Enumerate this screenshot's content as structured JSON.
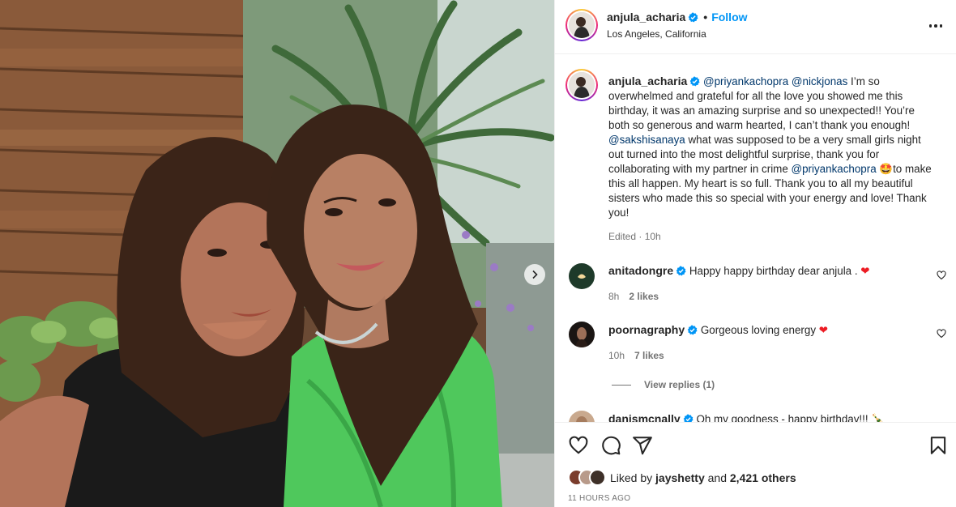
{
  "post": {
    "username": "anjula_acharia",
    "follow_label": "Follow",
    "dot": "•",
    "location": "Los Angeles, California"
  },
  "caption": {
    "username": "anjula_acharia",
    "mention1": "@priyankachopra",
    "mention2": "@nickjonas",
    "text1": " I’m so overwhelmed and grateful for all the love you showed me this birthday, it was an amazing surprise and so unexpected!! You’re both so generous and warm hearted, I can’t thank you enough! ",
    "mention3": "@sakshisanaya",
    "text2": " what was supposed to be a very small girls night out turned into the most delightful surprise, thank you for collaborating with my partner in crime ",
    "mention4": "@priyankachopra",
    "emoji": "🤩",
    "text3": "to make this all happen. My heart is so full. Thank you to all my beautiful sisters who made this so special with your energy and love! Thank you!",
    "meta": "Edited · 10h"
  },
  "comments": [
    {
      "username": "anitadongre",
      "text": "Happy happy birthday dear anjula . ",
      "emoji": "❤",
      "time": "8h",
      "likes": "2 likes"
    },
    {
      "username": "poornagraphy",
      "text": "Gorgeous loving energy ",
      "emoji": "❤",
      "time": "10h",
      "likes": "7 likes",
      "replies": "View replies (1)"
    },
    {
      "username": "danismcnally",
      "text": "Oh my goodness - happy birthday!!! 🍾"
    }
  ],
  "likes": {
    "prefix": "Liked by ",
    "user": "jayshetty",
    "mid": " and ",
    "others": "2,421 others"
  },
  "timestamp": "11 HOURS AGO",
  "colors": {
    "accent": "#0095f6",
    "verified": "#0095f6",
    "mention": "#00376b",
    "heart": "#ed1c24"
  }
}
